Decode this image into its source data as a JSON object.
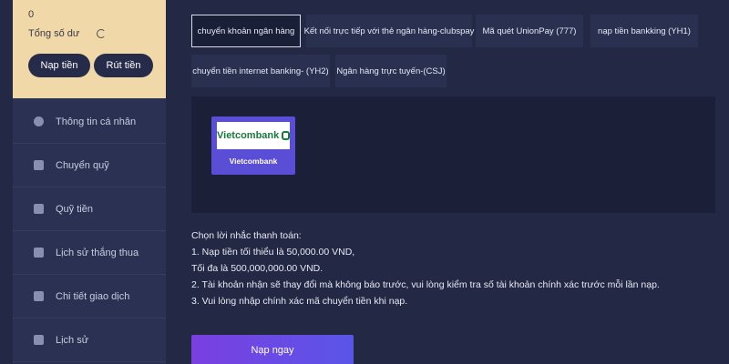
{
  "balance": {
    "value": "0",
    "label": "Tổng số dư"
  },
  "actions": {
    "deposit": "Nạp tiền",
    "withdraw": "Rút tiền"
  },
  "sidebar": {
    "items": [
      {
        "label": "Thông tin cá nhân",
        "icon": "user-icon"
      },
      {
        "label": "Chuyển quỹ",
        "icon": "wallet-icon"
      },
      {
        "label": "Quỹ tiền",
        "icon": "document-icon"
      },
      {
        "label": "Lịch sử thắng thua",
        "icon": "history-icon"
      },
      {
        "label": "Chi tiết giao dịch",
        "icon": "transaction-icon"
      },
      {
        "label": "Lịch sử",
        "icon": "list-icon"
      }
    ]
  },
  "tabs": [
    {
      "label": "chuyển khoản ngân hàng",
      "active": true
    },
    {
      "label": "Kết nối trực tiếp với thẻ ngân hàng-clubspay",
      "active": false
    },
    {
      "label": "Mã quét UnionPay  (777)",
      "active": false
    },
    {
      "label": "nạp tiền bankking  (YH1)",
      "active": false
    },
    {
      "label": "chuyển tiền internet banking-  (YH2)",
      "active": false
    },
    {
      "label": "Ngân hàng trực tuyến-(CSJ)",
      "active": false
    }
  ],
  "bank": {
    "logo_text": "Vietcombank",
    "name": "Vietcombank"
  },
  "notes": [
    "Chọn lời nhắc thanh toán:",
    "1. Nạp tiền tối thiểu là 50,000.00 VND,",
    "Tối đa là 500,000,000.00 VND.",
    "2. Tài khoản nhận sẽ thay đổi mà không báo trước, vui lòng kiểm tra số tài khoản chính xác trước mỗi lần nạp.",
    "3. Vui lòng nhập chính xác mã chuyển tiền khi nạp."
  ],
  "submit_label": "Nạp ngay",
  "colors": {
    "background": "#232845",
    "sidebar": "#2b3152",
    "balance_card": "#f0d8a8",
    "accent": "#6a4ae4"
  }
}
